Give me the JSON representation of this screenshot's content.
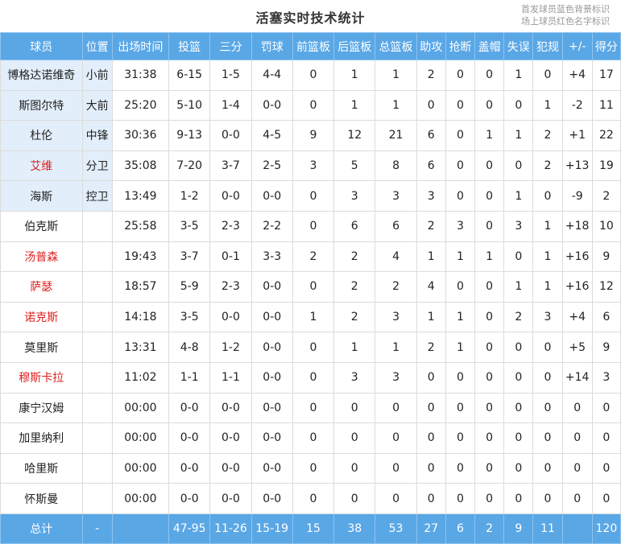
{
  "title": "活塞实时技术统计",
  "legend": [
    "首发球员蓝色背景标识",
    "场上球员红色名字标识"
  ],
  "columns": [
    "球员",
    "位置",
    "出场时间",
    "投篮",
    "三分",
    "罚球",
    "前篮板",
    "后篮板",
    "总篮板",
    "助攻",
    "抢断",
    "盖帽",
    "失误",
    "犯规",
    "+/-",
    "得分"
  ],
  "players": [
    {
      "name": "博格达诺维奇",
      "pos": "小前",
      "min": "31:38",
      "fg": "6-15",
      "tp": "1-5",
      "ft": "4-4",
      "oreb": "0",
      "dreb": "1",
      "reb": "1",
      "ast": "2",
      "stl": "0",
      "blk": "0",
      "tov": "1",
      "pf": "0",
      "pm": "+4",
      "pts": "17"
    },
    {
      "name": "斯图尔特",
      "pos": "大前",
      "min": "25:20",
      "fg": "5-10",
      "tp": "1-4",
      "ft": "0-0",
      "oreb": "0",
      "dreb": "1",
      "reb": "1",
      "ast": "0",
      "stl": "0",
      "blk": "0",
      "tov": "0",
      "pf": "1",
      "pm": "-2",
      "pts": "11"
    },
    {
      "name": "杜伦",
      "pos": "中锋",
      "min": "30:36",
      "fg": "9-13",
      "tp": "0-0",
      "ft": "4-5",
      "oreb": "9",
      "dreb": "12",
      "reb": "21",
      "ast": "6",
      "stl": "0",
      "blk": "1",
      "tov": "1",
      "pf": "2",
      "pm": "+1",
      "pts": "22"
    },
    {
      "name": "艾维",
      "pos": "分卫",
      "min": "35:08",
      "fg": "7-20",
      "tp": "3-7",
      "ft": "2-5",
      "oreb": "3",
      "dreb": "5",
      "reb": "8",
      "ast": "6",
      "stl": "0",
      "blk": "0",
      "tov": "0",
      "pf": "2",
      "pm": "+13",
      "pts": "19"
    },
    {
      "name": "海斯",
      "pos": "控卫",
      "min": "13:49",
      "fg": "1-2",
      "tp": "0-0",
      "ft": "0-0",
      "oreb": "0",
      "dreb": "3",
      "reb": "3",
      "ast": "3",
      "stl": "0",
      "blk": "0",
      "tov": "1",
      "pf": "0",
      "pm": "-9",
      "pts": "2"
    },
    {
      "name": "伯克斯",
      "pos": "",
      "min": "25:58",
      "fg": "3-5",
      "tp": "2-3",
      "ft": "2-2",
      "oreb": "0",
      "dreb": "6",
      "reb": "6",
      "ast": "2",
      "stl": "3",
      "blk": "0",
      "tov": "3",
      "pf": "1",
      "pm": "+18",
      "pts": "10"
    },
    {
      "name": "汤普森",
      "pos": "",
      "min": "19:43",
      "fg": "3-7",
      "tp": "0-1",
      "ft": "3-3",
      "oreb": "2",
      "dreb": "2",
      "reb": "4",
      "ast": "1",
      "stl": "1",
      "blk": "1",
      "tov": "0",
      "pf": "1",
      "pm": "+16",
      "pts": "9"
    },
    {
      "name": "萨瑟",
      "pos": "",
      "min": "18:57",
      "fg": "5-9",
      "tp": "2-3",
      "ft": "0-0",
      "oreb": "0",
      "dreb": "2",
      "reb": "2",
      "ast": "4",
      "stl": "0",
      "blk": "0",
      "tov": "1",
      "pf": "1",
      "pm": "+16",
      "pts": "12"
    },
    {
      "name": "诺克斯",
      "pos": "",
      "min": "14:18",
      "fg": "3-5",
      "tp": "0-0",
      "ft": "0-0",
      "oreb": "1",
      "dreb": "2",
      "reb": "3",
      "ast": "1",
      "stl": "1",
      "blk": "0",
      "tov": "2",
      "pf": "3",
      "pm": "+4",
      "pts": "6"
    },
    {
      "name": "莫里斯",
      "pos": "",
      "min": "13:31",
      "fg": "4-8",
      "tp": "1-2",
      "ft": "0-0",
      "oreb": "0",
      "dreb": "1",
      "reb": "1",
      "ast": "2",
      "stl": "1",
      "blk": "0",
      "tov": "0",
      "pf": "0",
      "pm": "+5",
      "pts": "9"
    },
    {
      "name": "穆斯卡拉",
      "pos": "",
      "min": "11:02",
      "fg": "1-1",
      "tp": "1-1",
      "ft": "0-0",
      "oreb": "0",
      "dreb": "3",
      "reb": "3",
      "ast": "0",
      "stl": "0",
      "blk": "0",
      "tov": "0",
      "pf": "0",
      "pm": "+14",
      "pts": "3"
    },
    {
      "name": "康宁汉姆",
      "pos": "",
      "min": "00:00",
      "fg": "0-0",
      "tp": "0-0",
      "ft": "0-0",
      "oreb": "0",
      "dreb": "0",
      "reb": "0",
      "ast": "0",
      "stl": "0",
      "blk": "0",
      "tov": "0",
      "pf": "0",
      "pm": "0",
      "pts": "0"
    },
    {
      "name": "加里纳利",
      "pos": "",
      "min": "00:00",
      "fg": "0-0",
      "tp": "0-0",
      "ft": "0-0",
      "oreb": "0",
      "dreb": "0",
      "reb": "0",
      "ast": "0",
      "stl": "0",
      "blk": "0",
      "tov": "0",
      "pf": "0",
      "pm": "0",
      "pts": "0"
    },
    {
      "name": "哈里斯",
      "pos": "",
      "min": "00:00",
      "fg": "0-0",
      "tp": "0-0",
      "ft": "0-0",
      "oreb": "0",
      "dreb": "0",
      "reb": "0",
      "ast": "0",
      "stl": "0",
      "blk": "0",
      "tov": "0",
      "pf": "0",
      "pm": "0",
      "pts": "0"
    },
    {
      "name": "怀斯曼",
      "pos": "",
      "min": "00:00",
      "fg": "0-0",
      "tp": "0-0",
      "ft": "0-0",
      "oreb": "0",
      "dreb": "0",
      "reb": "0",
      "ast": "0",
      "stl": "0",
      "blk": "0",
      "tov": "0",
      "pf": "0",
      "pm": "0",
      "pts": "0"
    }
  ],
  "starters": [
    "博格达诺维奇",
    "斯图尔特",
    "杜伦",
    "艾维",
    "海斯"
  ],
  "on_court": [
    "艾维",
    "汤普森",
    "萨瑟",
    "诺克斯",
    "穆斯卡拉"
  ],
  "totals": {
    "label": "总计",
    "pos": "-",
    "min": "",
    "fg": "47-95",
    "tp": "11-26",
    "ft": "15-19",
    "oreb": "15",
    "dreb": "38",
    "reb": "53",
    "ast": "27",
    "stl": "6",
    "blk": "2",
    "tov": "9",
    "pf": "11",
    "pm": "",
    "pts": "120"
  },
  "colors": {
    "header_bg": "#5aa7e6",
    "starter_bg": "#e2eefa",
    "oncourt_name": "#e02020"
  }
}
